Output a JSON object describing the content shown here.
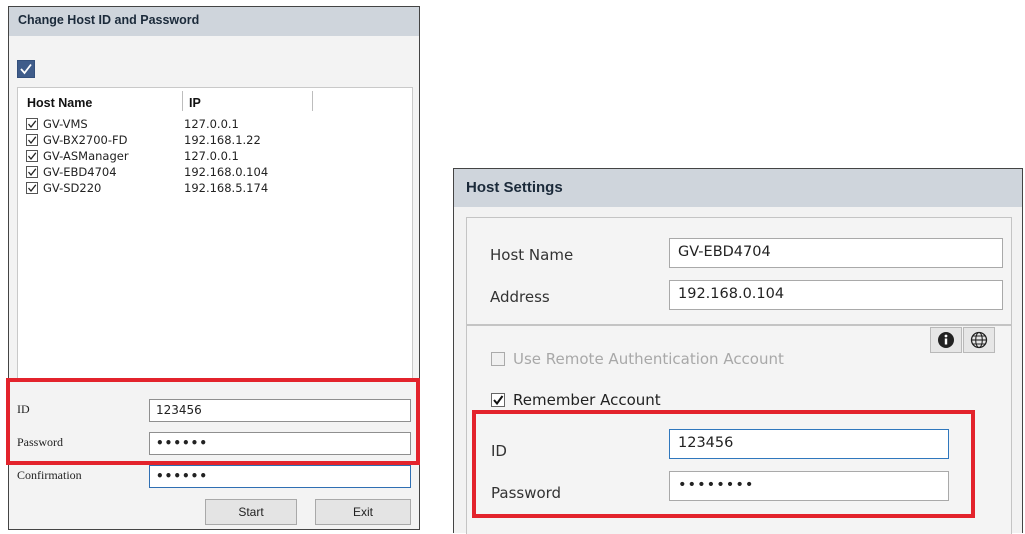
{
  "left_dialog": {
    "title": "Change Host ID and Password",
    "columns": [
      "Host Name",
      "IP"
    ],
    "hosts": [
      {
        "name": "GV-VMS",
        "ip": "127.0.0.1",
        "checked": true
      },
      {
        "name": "GV-BX2700-FD",
        "ip": "192.168.1.22",
        "checked": true
      },
      {
        "name": "GV-ASManager",
        "ip": "127.0.0.1",
        "checked": true
      },
      {
        "name": "GV-EBD4704",
        "ip": "192.168.0.104",
        "checked": true
      },
      {
        "name": "GV-SD220",
        "ip": "192.168.5.174",
        "checked": true
      }
    ],
    "id_label": "ID",
    "id_value": "123456",
    "password_label": "Password",
    "password_value": "••••••",
    "confirmation_label": "Confirmation",
    "confirmation_value": "••••••",
    "start_label": "Start",
    "exit_label": "Exit"
  },
  "right_dialog": {
    "title": "Host Settings",
    "host_name_label": "Host Name",
    "host_name_value": "GV-EBD4704",
    "address_label": "Address",
    "address_value": "192.168.0.104",
    "use_remote_label": "Use Remote Authentication Account",
    "remember_label": "Remember Account",
    "id_label": "ID",
    "id_value": "123456",
    "password_label": "Password",
    "password_value": "••••••••"
  },
  "colors": {
    "highlight": "#e3232c",
    "titlebar": "#cfd5dc",
    "checkbox_accent": "#3f5c8a"
  },
  "icons": [
    "checkmark-icon",
    "info-icon",
    "globe-icon"
  ]
}
